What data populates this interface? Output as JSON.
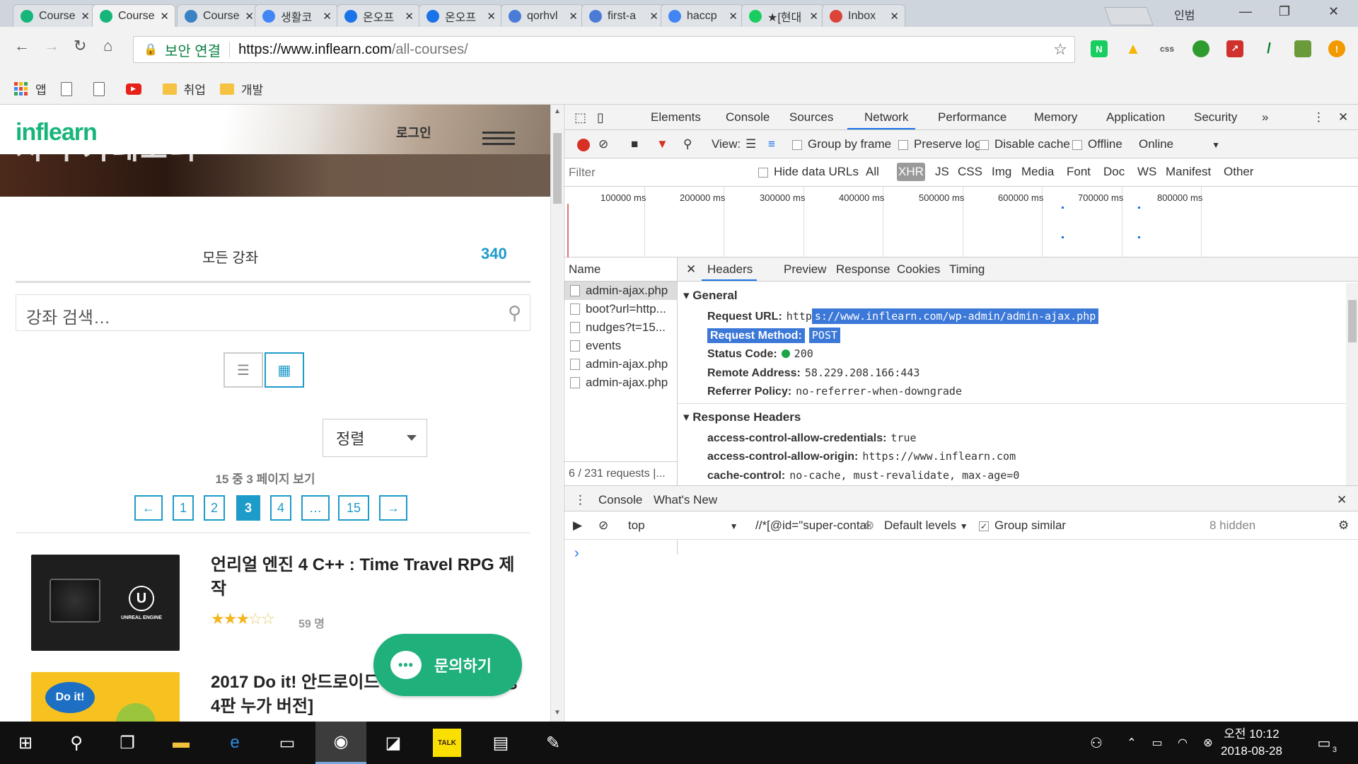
{
  "browser": {
    "tabs": [
      {
        "label": "Course",
        "icon": "inflearn-icon",
        "color": "#18b57a"
      },
      {
        "label": "Course",
        "icon": "inflearn-icon",
        "color": "#18b57a"
      },
      {
        "label": "Course",
        "icon": "udemy-icon",
        "color": "#3b82c4"
      },
      {
        "label": "생활코",
        "icon": "google-icon",
        "color": "#4285f4"
      },
      {
        "label": "온오프",
        "icon": "onoff-icon",
        "color": "#1a73e8"
      },
      {
        "label": "온오프",
        "icon": "onoff-icon",
        "color": "#1a73e8"
      },
      {
        "label": "qorhvl",
        "icon": "blog-icon",
        "color": "#4a7bd6"
      },
      {
        "label": "first-a",
        "icon": "blog-icon",
        "color": "#4a7bd6"
      },
      {
        "label": "haccp",
        "icon": "google-icon",
        "color": "#4285f4"
      },
      {
        "label": "★[현대",
        "icon": "naver-icon",
        "color": "#19ce60"
      },
      {
        "label": "Inbox",
        "icon": "inbox-icon",
        "color": "#db4437"
      }
    ],
    "incognito_label": "인범",
    "address": {
      "secure_label": "보안 연결",
      "url_host": "https://www.inflearn.com",
      "url_path": "/all-courses/"
    },
    "bookmarks": [
      {
        "label": "앱",
        "icon": "apps-icon"
      },
      {
        "label": "",
        "icon": "document-icon"
      },
      {
        "label": "",
        "icon": "document-icon"
      },
      {
        "label": "",
        "icon": "youtube-icon"
      },
      {
        "label": "취업",
        "icon": "folder-icon"
      },
      {
        "label": "개발",
        "icon": "folder-icon"
      }
    ],
    "extensions": [
      "N",
      "",
      "css",
      "",
      "",
      "/",
      "",
      "!"
    ]
  },
  "page": {
    "logo": "inflearn",
    "hero_title": "지식 카테고리",
    "login_label": "로그인",
    "all_courses_label": "모든 강좌",
    "course_count": "340",
    "search_placeholder": "강좌 검색…",
    "sort_label": "정렬",
    "page_of": "15 중 3 페이지 보기",
    "pagination": [
      "←",
      "1",
      "2",
      "3",
      "4",
      "…",
      "15",
      "→"
    ],
    "current_page": "3",
    "courses": [
      {
        "title": "언리얼 엔진 4 C++ : Time Travel RPG 제작",
        "rating": 3,
        "rating_max": 5,
        "students": "59 명",
        "thumb_label": "UNREAL ENGINE"
      },
      {
        "title": "2017 Do it! 안드로이드 앱 프로그래밍 개정 4판 누가 버전]",
        "thumb_label": "Do it!"
      }
    ],
    "chat_label": "문의하기"
  },
  "devtools": {
    "tabs": [
      "Elements",
      "Console",
      "Sources",
      "Network",
      "Performance",
      "Memory",
      "Application",
      "Security"
    ],
    "active_tab": "Network",
    "toolbar": {
      "view_label": "View:",
      "group_by_frame": "Group by frame",
      "preserve_log": "Preserve log",
      "disable_cache": "Disable cache",
      "offline": "Offline",
      "online": "Online"
    },
    "filter_placeholder": "Filter",
    "hide_data_urls": "Hide data URLs",
    "filter_types": [
      "All",
      "XHR",
      "JS",
      "CSS",
      "Img",
      "Media",
      "Font",
      "Doc",
      "WS",
      "Manifest",
      "Other"
    ],
    "active_filter": "XHR",
    "timeline_labels": [
      "100000 ms",
      "200000 ms",
      "300000 ms",
      "400000 ms",
      "500000 ms",
      "600000 ms",
      "700000 ms",
      "800000 ms"
    ],
    "requests_header": "Name",
    "requests": [
      "admin-ajax.php",
      "boot?url=http...",
      "nudges?t=15...",
      "events",
      "admin-ajax.php",
      "admin-ajax.php"
    ],
    "requests_footer": "6 / 231 requests  |...",
    "detail_tabs": [
      "Headers",
      "Preview",
      "Response",
      "Cookies",
      "Timing"
    ],
    "general": {
      "title": "General",
      "request_url_key": "Request URL:",
      "request_url_prefix": "http",
      "request_url_rest": "s://www.inflearn.com/wp-admin/admin-ajax.php",
      "request_method_key": "Request Method:",
      "request_method": "POST",
      "status_code_key": "Status Code:",
      "status_code": "200",
      "remote_address_key": "Remote Address:",
      "remote_address": "58.229.208.166:443",
      "referrer_policy_key": "Referrer Policy:",
      "referrer_policy": "no-referrer-when-downgrade"
    },
    "response_headers": {
      "title": "Response Headers",
      "rows": [
        {
          "key": "access-control-allow-credentials:",
          "value": "true"
        },
        {
          "key": "access-control-allow-origin:",
          "value": "https://www.inflearn.com"
        },
        {
          "key": "cache-control:",
          "value": "no-cache, must-revalidate, max-age=0"
        }
      ]
    },
    "drawer": {
      "tabs": [
        "Console",
        "What's New"
      ],
      "context": "top",
      "filter_value": "//*[@id=\"super-contai",
      "levels": "Default levels",
      "group_similar": "Group similar",
      "hidden": "8 hidden",
      "prompt": "›"
    }
  },
  "taskbar": {
    "time": "오전 10:12",
    "date": "2018-08-28",
    "notifications": "3"
  }
}
